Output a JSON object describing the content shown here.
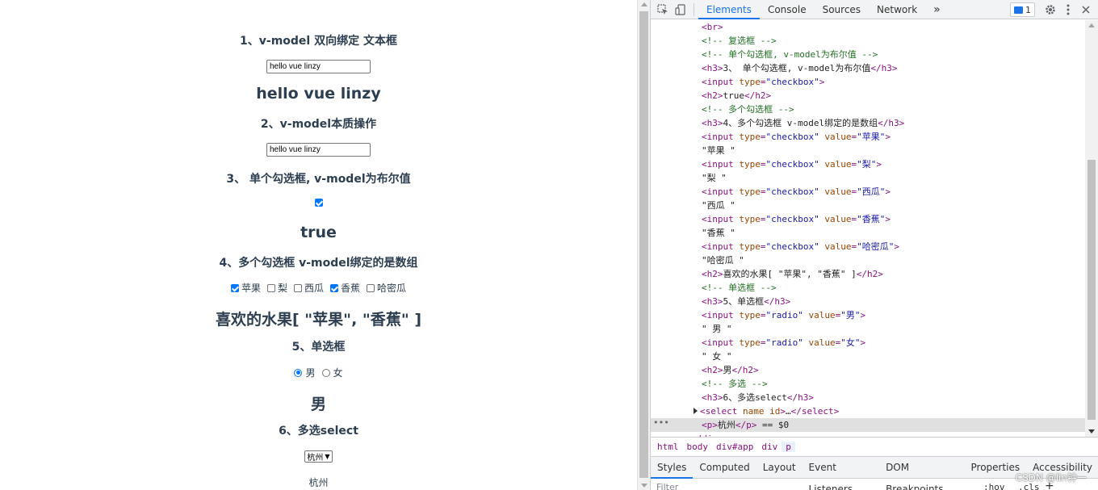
{
  "app": {
    "h3_1": "1、v-model 双向绑定 文本框",
    "input_1_value": "hello vue linzy",
    "h2_1": "hello vue linzy",
    "h3_2": "2、v-model本质操作",
    "input_2_value": "hello vue linzy",
    "h3_3": "3、 单个勾选框, v-model为布尔值",
    "h2_3": "true",
    "h3_4": "4、多个勾选框 v-model绑定的是数组",
    "fruits": [
      {
        "label": "苹果",
        "checked": true
      },
      {
        "label": "梨",
        "checked": false
      },
      {
        "label": "西瓜",
        "checked": false
      },
      {
        "label": "香蕉",
        "checked": true
      },
      {
        "label": "哈密瓜",
        "checked": false
      }
    ],
    "h2_4": "喜欢的水果[ \"苹果\", \"香蕉\" ]",
    "h3_5": "5、单选框",
    "radio_male": "男",
    "radio_female": "女",
    "h2_5": "男",
    "h3_6": "6、多选select",
    "select_value": "杭州",
    "p_text": "杭州"
  },
  "devtools": {
    "tabs": [
      "Elements",
      "Console",
      "Sources",
      "Network"
    ],
    "more": "»",
    "issues_count": "1",
    "dom_lines": [
      "<br>",
      "<!-- 复选框 -->",
      "<!-- 单个勾选框, v-model为布尔值 -->",
      "<h3>3、 单个勾选框, v-model为布尔值</h3>",
      "<input type=\"checkbox\">",
      "<h2>true</h2>",
      "<!-- 多个勾选框 -->",
      "<h3>4、多个勾选框 v-model绑定的是数组</h3>",
      "<input type=\"checkbox\" value=\"苹果\">",
      "\"苹果 \"",
      "<input type=\"checkbox\" value=\"梨\">",
      "\"梨 \"",
      "<input type=\"checkbox\" value=\"西瓜\">",
      "\"西瓜 \"",
      "<input type=\"checkbox\" value=\"香蕉\">",
      "\"香蕉 \"",
      "<input type=\"checkbox\" value=\"哈密瓜\">",
      "\"哈密瓜 \"",
      "<h2>喜欢的水果[ \"苹果\", \"香蕉\" ]</h2>",
      "<!-- 单选框 -->",
      "<h3>5、单选框</h3>",
      "<input type=\"radio\" value=\"男\">",
      "\" 男 \"",
      "<input type=\"radio\" value=\"女\">",
      "\" 女 \"",
      "<h2>男</h2>",
      "<!-- 多选 -->",
      "<h3>6、多选select</h3>",
      "<select name id>…</select>",
      "<p>杭州</p> == $0",
      "</div>"
    ],
    "dots": "•••",
    "breadcrumbs": [
      "html",
      "body",
      "div#app",
      "div",
      "p"
    ],
    "styles_tabs": [
      "Styles",
      "Computed",
      "Layout",
      "Event Listeners",
      "DOM Breakpoints",
      "Properties",
      "Accessibility"
    ],
    "filter_label": "Filter",
    "hov": ":hov",
    "cls": ".cls",
    "plus": "+"
  },
  "watermark": "CSDN @lin钟一"
}
